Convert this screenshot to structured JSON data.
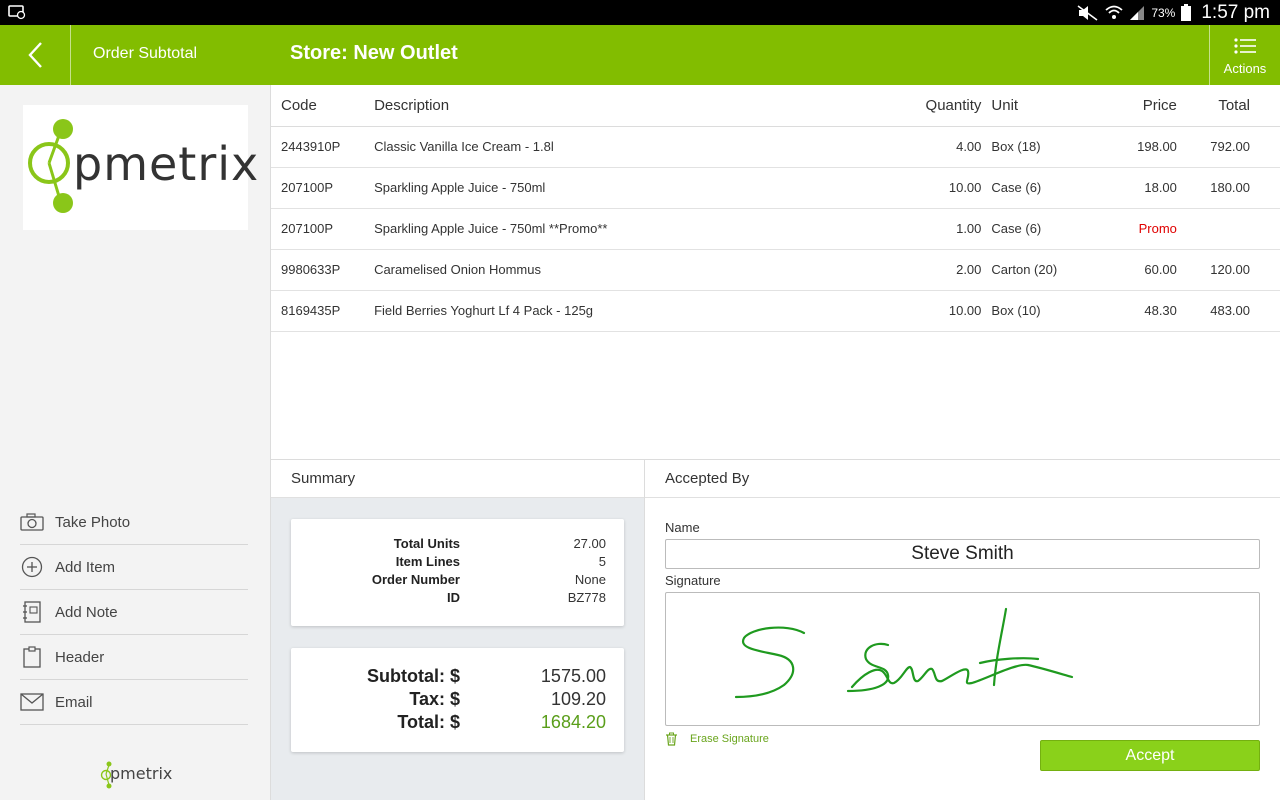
{
  "status_bar": {
    "battery": "73%",
    "time": "1:57 pm"
  },
  "app_bar": {
    "subtitle": "Order Subtotal",
    "title": "Store: New Outlet",
    "actions_label": "Actions"
  },
  "sidebar": {
    "logo_text": "pmetrix",
    "footer_logo_text": "pmetrix",
    "menu": [
      {
        "label": "Take Photo",
        "icon": "camera-icon"
      },
      {
        "label": "Add Item",
        "icon": "plus-circle-icon"
      },
      {
        "label": "Add Note",
        "icon": "notebook-icon"
      },
      {
        "label": "Header",
        "icon": "clipboard-icon"
      },
      {
        "label": "Email",
        "icon": "envelope-icon"
      }
    ]
  },
  "order_table": {
    "headers": {
      "code": "Code",
      "description": "Description",
      "quantity": "Quantity",
      "unit": "Unit",
      "price": "Price",
      "total": "Total"
    },
    "rows": [
      {
        "code": "2443910P",
        "description": "Classic Vanilla Ice Cream - 1.8l",
        "quantity": "4.00",
        "unit": "Box (18)",
        "price": "198.00",
        "total": "792.00"
      },
      {
        "code": "207100P",
        "description": "Sparkling Apple Juice - 750ml",
        "quantity": "10.00",
        "unit": "Case (6)",
        "price": "18.00",
        "total": "180.00"
      },
      {
        "code": "207100P",
        "description": "Sparkling Apple Juice - 750ml **Promo**",
        "quantity": "1.00",
        "unit": "Case (6)",
        "price": "Promo",
        "total": ""
      },
      {
        "code": "9980633P",
        "description": "Caramelised Onion Hommus",
        "quantity": "2.00",
        "unit": "Carton (20)",
        "price": "60.00",
        "total": "120.00"
      },
      {
        "code": "8169435P",
        "description": "Field Berries Yoghurt Lf 4 Pack - 125g",
        "quantity": "10.00",
        "unit": "Box (10)",
        "price": "48.30",
        "total": "483.00"
      }
    ]
  },
  "summary": {
    "header": "Summary",
    "details": [
      {
        "label": "Total Units",
        "value": "27.00"
      },
      {
        "label": "Item Lines",
        "value": "5"
      },
      {
        "label": "Order Number",
        "value": "None"
      },
      {
        "label": "ID",
        "value": "BZ778"
      }
    ],
    "totals": [
      {
        "label": "Subtotal: $",
        "value": "1575.00"
      },
      {
        "label": "Tax: $",
        "value": "109.20"
      },
      {
        "label": "Total: $",
        "value": "1684.20"
      }
    ],
    "total_color": "#5a9e1a"
  },
  "accepted_by": {
    "header": "Accepted By",
    "name_label": "Name",
    "name_value": "Steve Smith",
    "signature_label": "Signature",
    "erase_label": "Erase Signature",
    "accept_label": "Accept"
  },
  "colors": {
    "brand_green": "#82bd00",
    "accept_green": "#8ad11a",
    "promo_red": "#e00000",
    "signature_ink": "#1f9a1f"
  }
}
